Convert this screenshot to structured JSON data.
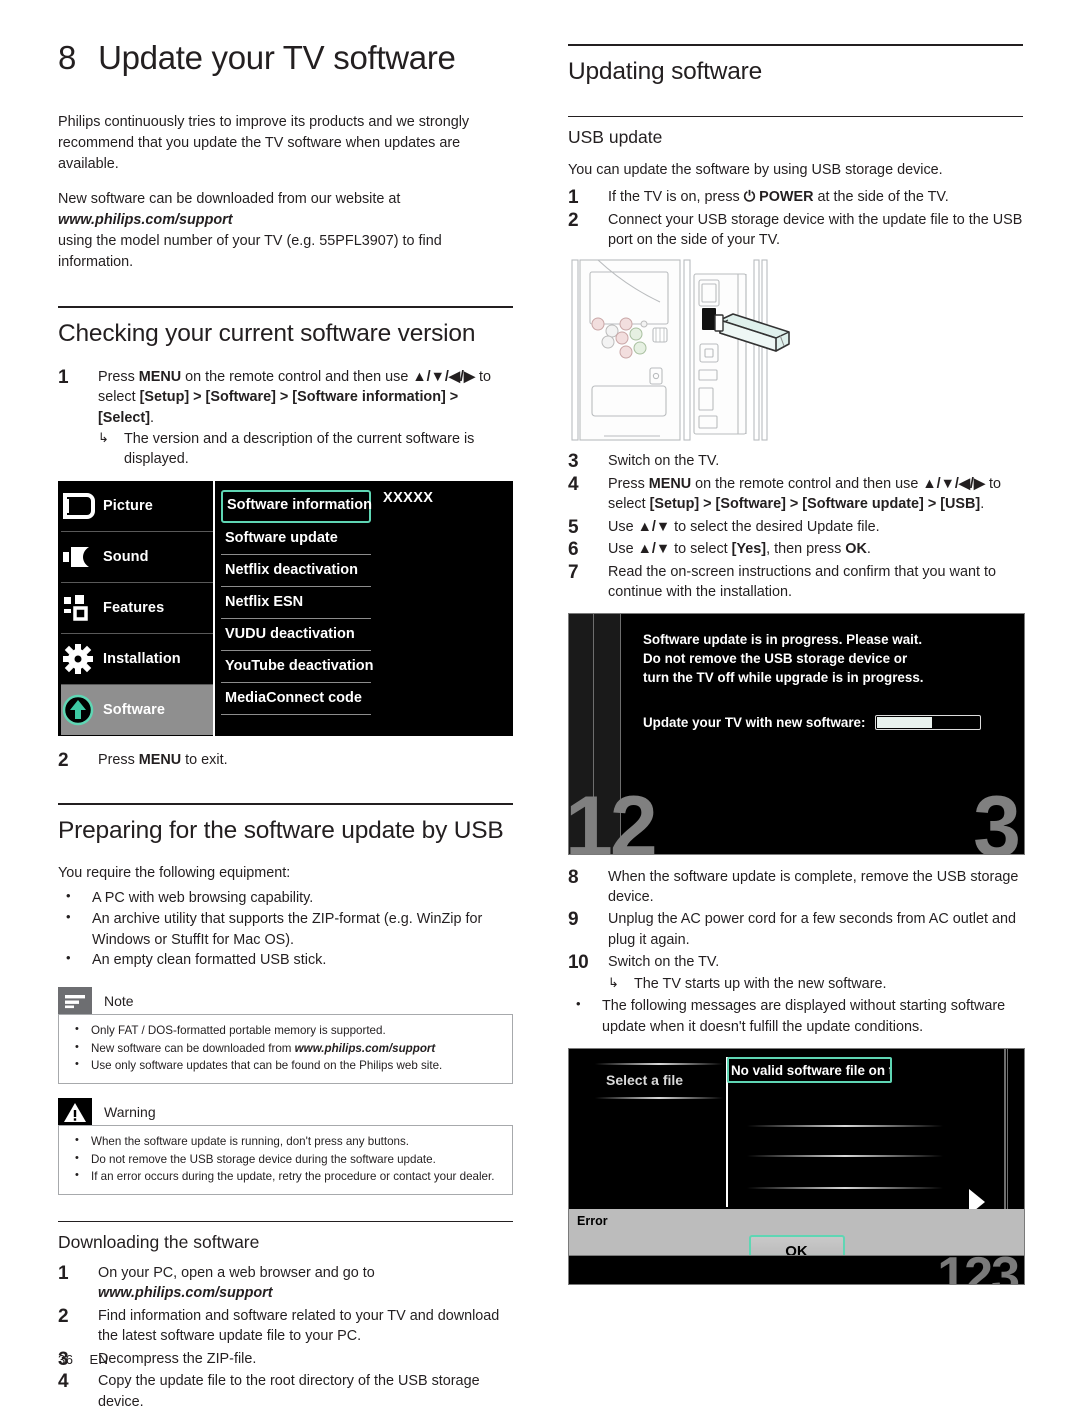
{
  "chapter": {
    "number": "8",
    "title": "Update your TV software"
  },
  "intro": {
    "para1": "Philips continuously tries to improve its products and we strongly recommend that you update the TV software when updates are available.",
    "para2_line1": "New software can be downloaded from our website at",
    "para2_url": "www.philips.com/support",
    "para2_line2": "using the model number of your TV (e.g. 55PFL3907) to find information."
  },
  "checking": {
    "heading": "Checking your current software version",
    "step1": {
      "num": "1",
      "text_a": "Press ",
      "menu": "MENU",
      "text_b": " on the remote control and then use ",
      "arrows": "▲/▼/◀/▶",
      "text_c": " to select ",
      "path": "[Setup] > [Software] > [Software information] > [Select]",
      "text_d": ".",
      "result": "The version and a description of the current software is displayed."
    },
    "step2": {
      "num": "2",
      "text_a": "Press ",
      "menu": "MENU",
      "text_b": " to exit."
    }
  },
  "tv_menu": {
    "sidebar": [
      {
        "label": "Picture",
        "icon": "picture-icon",
        "active": false
      },
      {
        "label": "Sound",
        "icon": "speaker-icon",
        "active": false
      },
      {
        "label": "Features",
        "icon": "features-icon",
        "active": false
      },
      {
        "label": "Installation",
        "icon": "gear-icon",
        "active": false
      },
      {
        "label": "Software",
        "icon": "up-arrow-circle-icon",
        "active": true
      }
    ],
    "items": [
      {
        "label": "Software information",
        "selected": true
      },
      {
        "label": "Software update",
        "selected": false
      },
      {
        "label": "Netflix deactivation",
        "selected": false
      },
      {
        "label": "Netflix ESN",
        "selected": false
      },
      {
        "label": "VUDU deactivation",
        "selected": false
      },
      {
        "label": "YouTube deactivation",
        "selected": false
      },
      {
        "label": "MediaConnect code",
        "selected": false
      }
    ],
    "value": "XXXXX",
    "highlight_color": "#5fd6b4"
  },
  "preparing": {
    "heading": "Preparing for the software update by USB",
    "lead": "You require the following equipment:",
    "bullets": [
      "A PC with web browsing capability.",
      "An archive utility that supports the ZIP-format (e.g. WinZip for Windows or StuffIt for Mac OS).",
      "An empty clean formatted USB stick."
    ]
  },
  "note": {
    "title": "Note",
    "icon": "note-lines-icon",
    "items_pre": [
      "Only FAT / DOS-formatted portable memory is supported.",
      "New software can be downloaded from ",
      "Use only software updates that can be found on the Philips web site."
    ],
    "item2_url": "www.philips.com/support"
  },
  "warning": {
    "title": "Warning",
    "icon": "warning-triangle-icon",
    "items": [
      "When the software update is running, don't press any buttons.",
      "Do not remove the USB storage device during the software update.",
      "If an error occurs during the update, retry the procedure or contact your dealer."
    ]
  },
  "downloading": {
    "heading": "Downloading the software",
    "steps": [
      {
        "num": "1",
        "text": "On your PC, open a web browser and go to",
        "url": "www.philips.com/support"
      },
      {
        "num": "2",
        "text": "Find information and software related to your TV and download the latest software update file to your PC."
      },
      {
        "num": "3",
        "text": "Decompress the ZIP-file."
      },
      {
        "num": "4",
        "text": "Copy the update file to the root directory of the USB storage device."
      }
    ]
  },
  "updating": {
    "heading": "Updating software",
    "usb_heading": "USB update",
    "lead": "You can update the software by using USB storage device.",
    "step1": {
      "num": "1",
      "text_a": "If the TV is on, press ",
      "power_icon": "⏻",
      "power_label": "POWER",
      "text_b": " at the side of the TV."
    },
    "step2": {
      "num": "2",
      "text": "Connect your USB storage device with the update file to the USB port on the side of your TV."
    },
    "step3": {
      "num": "3",
      "text": "Switch on the TV."
    },
    "step4": {
      "num": "4",
      "text_a": "Press ",
      "menu": "MENU",
      "text_b": " on the remote control and then use ",
      "arrows": "▲/▼/◀/▶",
      "text_c": " to select ",
      "path": "[Setup] > [Software] > [Software update] > [USB]",
      "text_d": "."
    },
    "step5": {
      "num": "5",
      "text_a": "Use ",
      "arrows": "▲/▼",
      "text_b": " to select the desired Update file."
    },
    "step6": {
      "num": "6",
      "text_a": "Use ",
      "arrows": "▲/▼",
      "text_b": " to select ",
      "yes": "[Yes]",
      "text_c": ", then press ",
      "ok": "OK",
      "text_d": "."
    },
    "step7": {
      "num": "7",
      "text": "Read the on-screen instructions and confirm that you want to continue with the installation."
    },
    "step8": {
      "num": "8",
      "text": "When the software update is complete, remove the USB storage device."
    },
    "step9": {
      "num": "9",
      "text": "Unplug the AC power cord for a few seconds from AC outlet and plug it again."
    },
    "step10": {
      "num": "10",
      "text": "Switch on the TV.",
      "result": "The TV starts up with the new software."
    },
    "final_bullet": "The following messages are displayed without starting software update when it doesn't fulfill the update conditions."
  },
  "progress_screen": {
    "line1": "Software update is in progress. Please wait.",
    "line2": "Do not remove the USB storage device or",
    "line3": "turn the TV off while upgrade is in progress.",
    "bar_label": "Update your TV with new software:",
    "progress_percent": 52,
    "watermark_left": "12",
    "watermark_right": "3"
  },
  "error_screen": {
    "left_label": "Select a file",
    "message": "No valid software file on the USB. Chec",
    "dialog_title": "Error",
    "ok_label": "OK",
    "watermark": "123",
    "highlight_color": "#5fd6b4"
  },
  "footer": {
    "page": "36",
    "lang": "EN"
  }
}
